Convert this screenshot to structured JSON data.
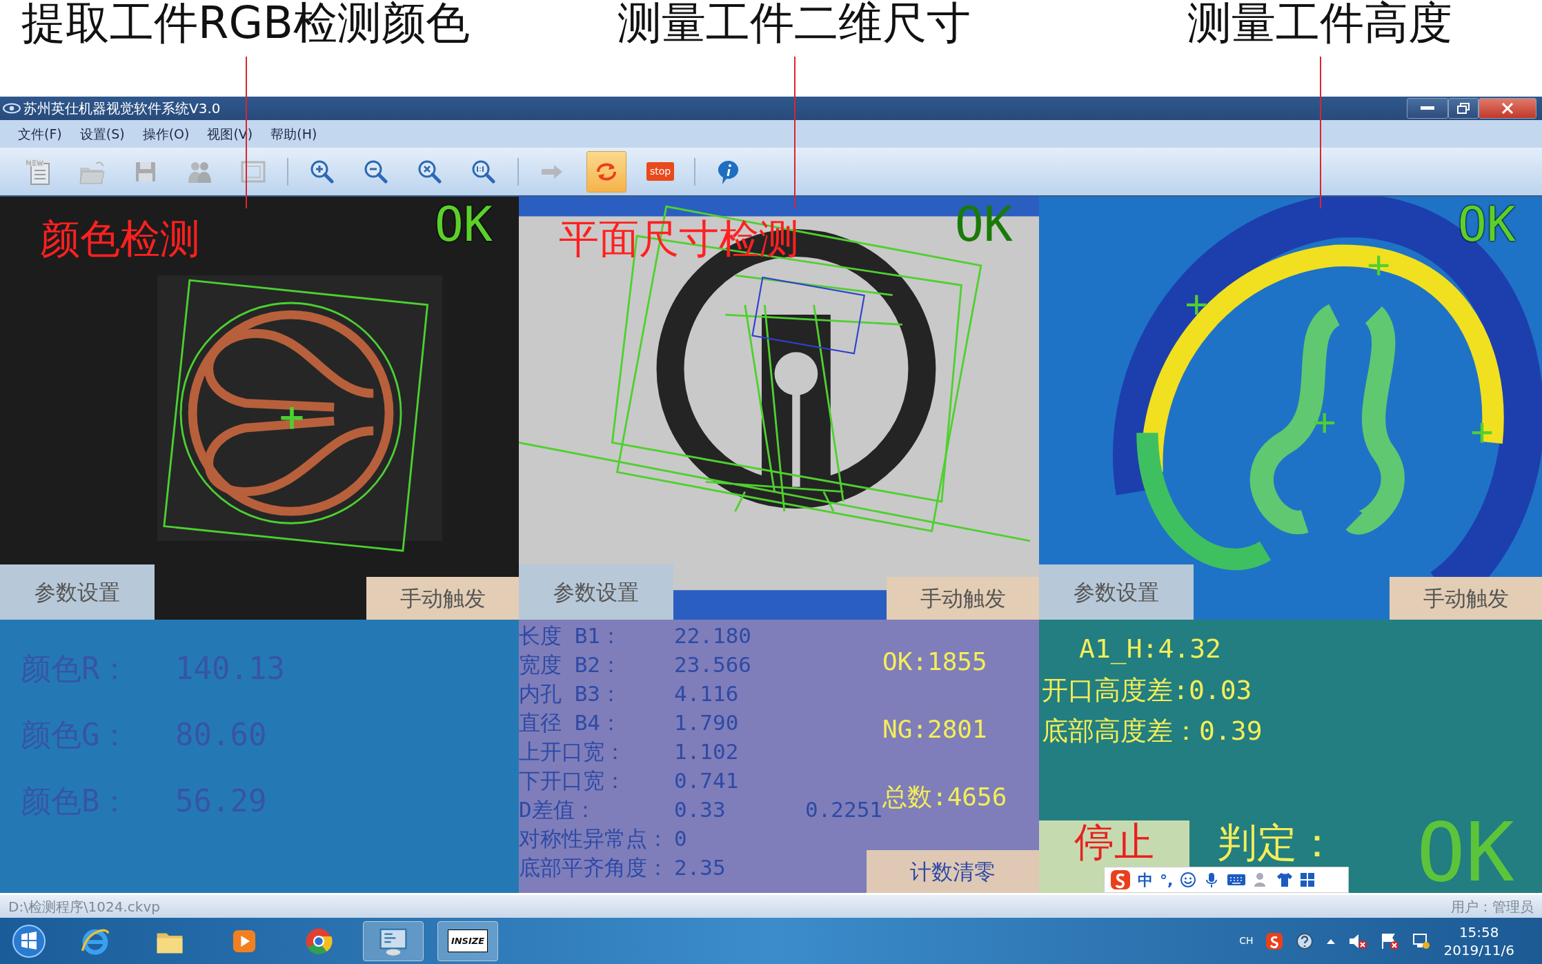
{
  "annotations": [
    {
      "text": "提取工件RGB检测颜色"
    },
    {
      "text": "测量工件二维尺寸"
    },
    {
      "text": "测量工件高度"
    }
  ],
  "window": {
    "title": "苏州英仕机器视觉软件系统V3.0"
  },
  "menu": [
    "文件(F)",
    "设置(S)",
    "操作(O)",
    "视图(V)",
    "帮助(H)"
  ],
  "toolbar": [
    {
      "kind": "new",
      "disabled": true
    },
    {
      "kind": "open",
      "disabled": true
    },
    {
      "kind": "save",
      "disabled": true
    },
    {
      "kind": "users",
      "disabled": true
    },
    {
      "kind": "frame",
      "disabled": true
    },
    {
      "kind": "separator"
    },
    {
      "kind": "zoom-in",
      "disabled": false
    },
    {
      "kind": "zoom-out",
      "disabled": false
    },
    {
      "kind": "zoom-fit",
      "disabled": false
    },
    {
      "kind": "zoom-actual",
      "disabled": false
    },
    {
      "kind": "separator"
    },
    {
      "kind": "arrow",
      "disabled": true
    },
    {
      "kind": "loop",
      "disabled": false,
      "selected": true
    },
    {
      "kind": "stop",
      "disabled": false,
      "label": "stop"
    },
    {
      "kind": "separator"
    },
    {
      "kind": "info",
      "disabled": false
    }
  ],
  "panels": [
    {
      "kind": "color",
      "title": "颜色检测",
      "status": "OK",
      "buttons": [
        "参数设置",
        "手动触发"
      ]
    },
    {
      "kind": "dimension",
      "title": "平面尺寸检测",
      "status": "OK",
      "buttons": [
        "参数设置",
        "手动触发"
      ]
    },
    {
      "kind": "height",
      "status": "OK",
      "buttons": [
        "参数设置",
        "手动触发"
      ]
    }
  ],
  "color_readout": [
    {
      "label": "颜色R：",
      "value": "140.13"
    },
    {
      "label": "颜色G：",
      "value": "80.60"
    },
    {
      "label": "颜色B：",
      "value": "56.29"
    }
  ],
  "dimension_readout": {
    "rows": [
      {
        "label": "长度 B1：",
        "value": "22.180"
      },
      {
        "label": "宽度 B2：",
        "value": "23.566"
      },
      {
        "label": "内孔 B3：",
        "value": "4.116"
      },
      {
        "label": "直径 B4：",
        "value": "1.790"
      },
      {
        "label": "上开口宽：",
        "value": "1.102"
      },
      {
        "label": "下开口宽：",
        "value": "0.741"
      },
      {
        "label": "D差值：",
        "value": "0.33",
        "extra": "0.2251"
      },
      {
        "label": "对称性异常点：",
        "value": "0"
      },
      {
        "label": "底部平齐角度：",
        "value": "2.35"
      }
    ],
    "counts": [
      "OK:1855",
      "NG:2801",
      "总数:4656"
    ],
    "reset_button": "计数清零"
  },
  "height_readout": {
    "lines": [
      "A1_H:4.32",
      "开口高度差:0.03",
      "底部高度差：0.39"
    ],
    "stop_button": "停止",
    "verdict_label": "判定：",
    "verdict": "OK"
  },
  "ime_bar": {
    "mode": "中",
    "punct": "°,"
  },
  "status_bar": {
    "path": "D:\\检测程序\\1024.ckvp",
    "user": "用户：管理员"
  },
  "taskbar": {
    "apps": [
      {
        "kind": "ie",
        "selected": false
      },
      {
        "kind": "folder",
        "selected": false
      },
      {
        "kind": "media",
        "selected": false
      },
      {
        "kind": "chrome",
        "selected": false
      },
      {
        "kind": "vision",
        "selected": true
      },
      {
        "kind": "insize",
        "selected": true,
        "label": "INSIZE"
      }
    ],
    "lang": "CH",
    "time": "15:58",
    "date": "2019/11/6"
  }
}
